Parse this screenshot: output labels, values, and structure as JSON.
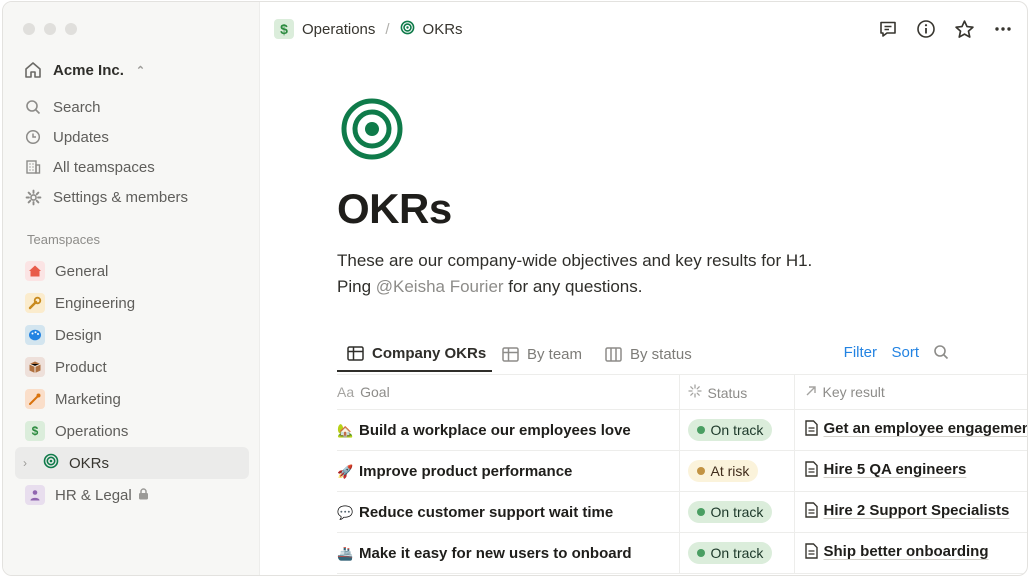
{
  "workspace": {
    "name": "Acme Inc."
  },
  "nav": [
    {
      "label": "Search",
      "icon": "search-icon"
    },
    {
      "label": "Updates",
      "icon": "clock-icon"
    },
    {
      "label": "All teamspaces",
      "icon": "building-icon"
    },
    {
      "label": "Settings & members",
      "icon": "gear-icon"
    }
  ],
  "teamspaces_label": "Teamspaces",
  "teamspaces": [
    {
      "label": "General",
      "icon": "house-icon",
      "color": "#e85c4a"
    },
    {
      "label": "Engineering",
      "icon": "wrench-icon",
      "color": "#e0a33b"
    },
    {
      "label": "Design",
      "icon": "palette-icon",
      "color": "#2383e2"
    },
    {
      "label": "Product",
      "icon": "box-icon",
      "color": "#b0713f"
    },
    {
      "label": "Marketing",
      "icon": "megaphone-icon",
      "color": "#d9730d"
    },
    {
      "label": "Operations",
      "icon": "dollar-icon",
      "color": "#2b8a3e"
    },
    {
      "label": "OKRs",
      "icon": "target-icon",
      "color": "#0f7b4a"
    },
    {
      "label": "HR & Legal",
      "icon": "person-icon",
      "color": "#9065b0"
    }
  ],
  "breadcrumb": {
    "parent": "Operations",
    "separator": "/",
    "current": "OKRs"
  },
  "page": {
    "title": "OKRs",
    "desc_line1": "These are our company-wide objectives and key results for H1.",
    "desc_ping": "Ping ",
    "desc_mention": "@Keisha Fourier",
    "desc_end": " for any questions."
  },
  "tabs": [
    {
      "label": "Company OKRs"
    },
    {
      "label": "By team"
    },
    {
      "label": "By status"
    }
  ],
  "toolbar": {
    "filter": "Filter",
    "sort": "Sort"
  },
  "columns": {
    "goal": "Goal",
    "goal_prefix": "Aa",
    "status": "Status",
    "key_result": "Key result"
  },
  "rows": [
    {
      "emoji": "🏡",
      "goal": "Build a workplace our employees love",
      "status": "On track",
      "kr": "Get an employee engagement"
    },
    {
      "emoji": "🚀",
      "goal": "Improve product performance",
      "status": "At risk",
      "kr": "Hire 5 QA engineers"
    },
    {
      "emoji": "💬",
      "goal": "Reduce customer support wait time",
      "status": "On track",
      "kr": "Hire 2 Support Specialists"
    },
    {
      "emoji": "🚢",
      "goal": "Make it easy for new users to onboard",
      "status": "On track",
      "kr": "Ship better onboarding"
    }
  ],
  "colors": {
    "accent": "#2383e2",
    "target": "#0f7b4a",
    "on_track": "#dbeddb",
    "at_risk": "#fbf3db"
  }
}
